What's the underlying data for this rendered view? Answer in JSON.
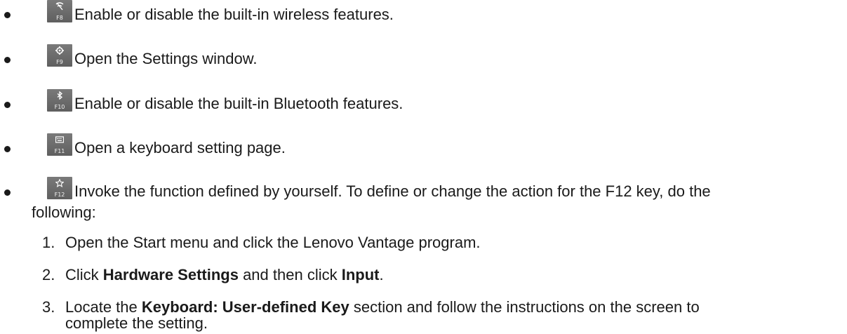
{
  "bullets": [
    {
      "key": "F8",
      "icon": "wireless-off-icon",
      "text": "Enable or disable the built-in wireless features."
    },
    {
      "key": "F9",
      "icon": "gear-icon",
      "text": "Open the Settings window."
    },
    {
      "key": "F10",
      "icon": "bluetooth-icon",
      "text": "Enable or disable the built-in Bluetooth features."
    },
    {
      "key": "F11",
      "icon": "keyboard-icon",
      "text": "Open a keyboard setting page."
    },
    {
      "key": "F12",
      "icon": "star-icon",
      "text_line1": "Invoke the function defined by yourself. To define or change the action for the F12 key, do the",
      "text_line2": "following:"
    }
  ],
  "steps": [
    {
      "num": "1.",
      "text": "Open the Start menu and click the Lenovo Vantage program."
    },
    {
      "num": "2.",
      "pre": "Click ",
      "b1": "Hardware Settings",
      "mid": " and then click ",
      "b2": "Input",
      "post": "."
    },
    {
      "num": "3.",
      "pre": "Locate the ",
      "b1": "Keyboard: User-defined Key",
      "post": " section and follow the instructions on the screen to",
      "line2": "complete the setting."
    }
  ]
}
